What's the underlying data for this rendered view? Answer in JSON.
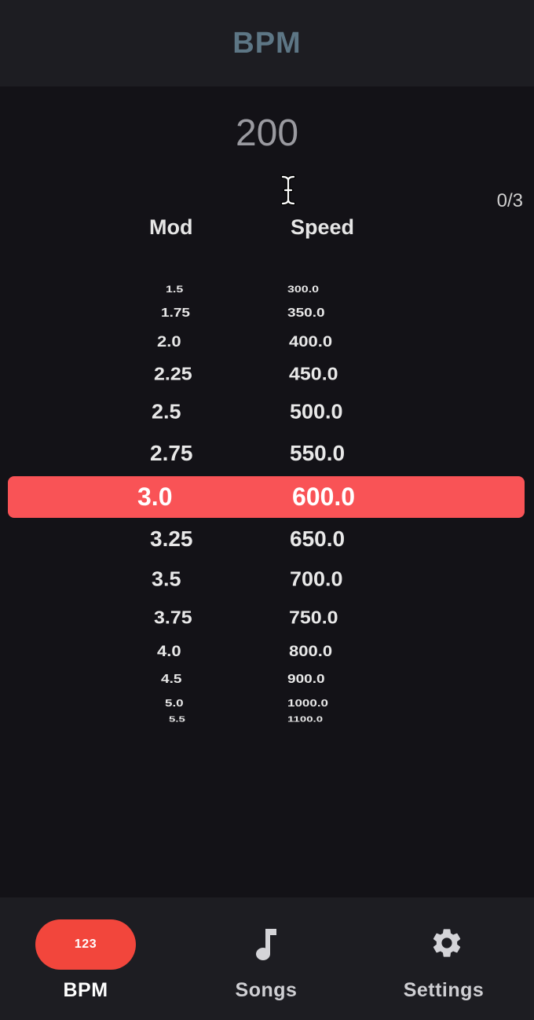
{
  "header": {
    "title": "BPM"
  },
  "bpm": {
    "value": "200"
  },
  "counter": "0/3",
  "columns": {
    "mod": "Mod",
    "speed": "Speed"
  },
  "rows": [
    {
      "mod": "1.5",
      "speed": "300.0"
    },
    {
      "mod": "1.75",
      "speed": "350.0"
    },
    {
      "mod": "2.0",
      "speed": "400.0"
    },
    {
      "mod": "2.25",
      "speed": "450.0"
    },
    {
      "mod": "2.5",
      "speed": "500.0"
    },
    {
      "mod": "2.75",
      "speed": "550.0"
    },
    {
      "mod": "3.25",
      "speed": "650.0"
    },
    {
      "mod": "3.5",
      "speed": "700.0"
    },
    {
      "mod": "3.75",
      "speed": "750.0"
    },
    {
      "mod": "4.0",
      "speed": "800.0"
    },
    {
      "mod": "4.5",
      "speed": "900.0"
    },
    {
      "mod": "5.0",
      "speed": "1000.0"
    },
    {
      "mod": "5.5",
      "speed": "1100.0"
    }
  ],
  "selected": {
    "mod": "3.0",
    "speed": "600.0"
  },
  "tabs": [
    {
      "label": "BPM",
      "icon": "123",
      "icon_name": "numbers-icon",
      "active": true
    },
    {
      "label": "Songs",
      "icon_name": "music-note-icon",
      "active": false
    },
    {
      "label": "Settings",
      "icon_name": "gear-icon",
      "active": false
    }
  ],
  "colors": {
    "accent": "#f95356",
    "tab_pill": "#f2463c",
    "header_title": "#5d7685",
    "background": "#131217"
  }
}
